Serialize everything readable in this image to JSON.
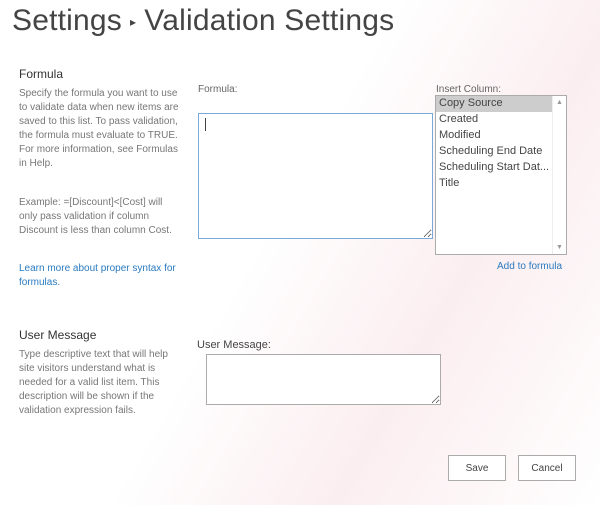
{
  "header": {
    "crumb": "Settings",
    "separator": "▸",
    "title": "Validation Settings"
  },
  "formula_section": {
    "heading": "Formula",
    "description": "Specify the formula you want to use to validate data when new items are saved to this list. To pass validation, the formula must evaluate to TRUE. For more information, see Formulas in Help.",
    "example": "Example: =[Discount]<[Cost] will only pass validation if column Discount is less than column Cost.",
    "link": "Learn more about proper syntax for formulas.",
    "formula_label": "Formula:",
    "formula_value": "",
    "insert_label": "Insert Column:",
    "columns": [
      "Copy Source",
      "Created",
      "Modified",
      "Scheduling End Date",
      "Scheduling Start Dat...",
      "Title"
    ],
    "selected": "Copy Source",
    "add_link": "Add to formula"
  },
  "message_section": {
    "heading": "User Message",
    "description": "Type descriptive text that will help site visitors understand what is needed for a valid list item. This description will be shown if the validation expression fails.",
    "label": "User Message:",
    "value": ""
  },
  "buttons": {
    "save": "Save",
    "cancel": "Cancel"
  }
}
